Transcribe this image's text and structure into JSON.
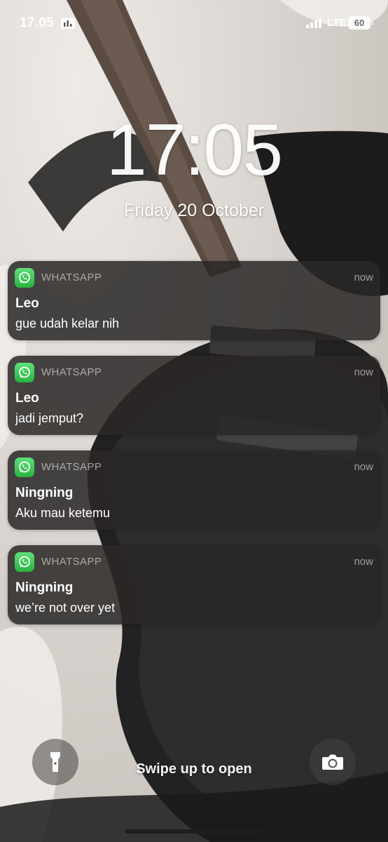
{
  "status_bar": {
    "time": "17.05",
    "network": "LTE",
    "battery": "60"
  },
  "lock_screen": {
    "time": "17:05",
    "date": "Friday 20 October"
  },
  "notifications": [
    {
      "app": "WHATSAPP",
      "time": "now",
      "sender": "Leo",
      "message": "gue udah kelar nih"
    },
    {
      "app": "WHATSAPP",
      "time": "now",
      "sender": "Leo",
      "message": "jadi jemput?"
    },
    {
      "app": "WHATSAPP",
      "time": "now",
      "sender": "Ningning",
      "message": "Aku mau ketemu"
    },
    {
      "app": "WHATSAPP",
      "time": "now",
      "sender": "Ningning",
      "message": "we’re not over yet"
    }
  ],
  "bottom": {
    "swipe_hint": "Swipe up to open"
  },
  "colors": {
    "whatsapp_green": "#27b43f",
    "notification_bg": "#2a2826"
  },
  "icons": [
    "flashlight-icon",
    "camera-icon",
    "whatsapp-icon",
    "signal-icon",
    "battery-icon"
  ]
}
